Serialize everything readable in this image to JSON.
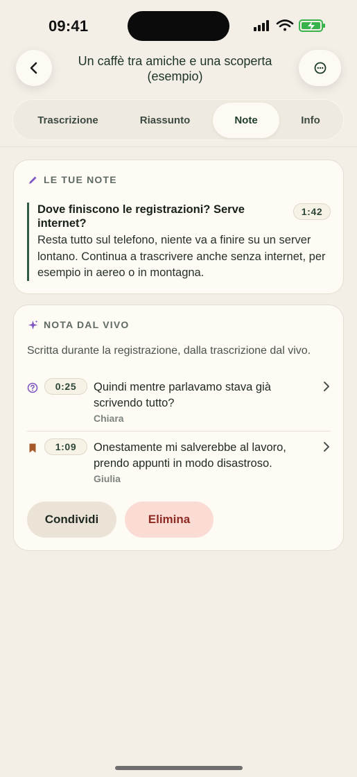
{
  "status_bar": {
    "time": "09:41"
  },
  "header": {
    "title": "Un caffè tra amiche e una scoperta (esempio)"
  },
  "tabs": [
    {
      "label": "Trascrizione",
      "active": false
    },
    {
      "label": "Riassunto",
      "active": false
    },
    {
      "label": "Note",
      "active": true
    },
    {
      "label": "Info",
      "active": false
    }
  ],
  "notes_card": {
    "section_label": "LE TUE NOTE",
    "note": {
      "title": "Dove finiscono le registrazioni? Serve internet?",
      "timestamp": "1:42",
      "body": "Resta tutto sul telefono, niente va a finire su un server lontano. Continua a trascrivere anche senza internet, per esempio in aereo o in montagna."
    }
  },
  "live_card": {
    "section_label": "NOTA DAL VIVO",
    "description": "Scritta durante la registrazione, dalla trascrizione dal vivo.",
    "items": [
      {
        "icon": "question-circle-icon",
        "timestamp": "0:25",
        "text": "Quindi mentre parlavamo stava già scrivendo tutto?",
        "speaker": "Chiara"
      },
      {
        "icon": "bookmark-icon",
        "timestamp": "1:09",
        "text": "Onestamente mi salverebbe al lavoro, prendo appunti in modo disastroso.",
        "speaker": "Giulia"
      }
    ],
    "share_label": "Condividi",
    "delete_label": "Elimina"
  },
  "colors": {
    "accent": "#2F5A43",
    "purple_icon": "#7E57C2",
    "bookmark": "#A65A2A",
    "delete_text": "#8E2B22",
    "delete_bg": "#FBDCD5"
  }
}
